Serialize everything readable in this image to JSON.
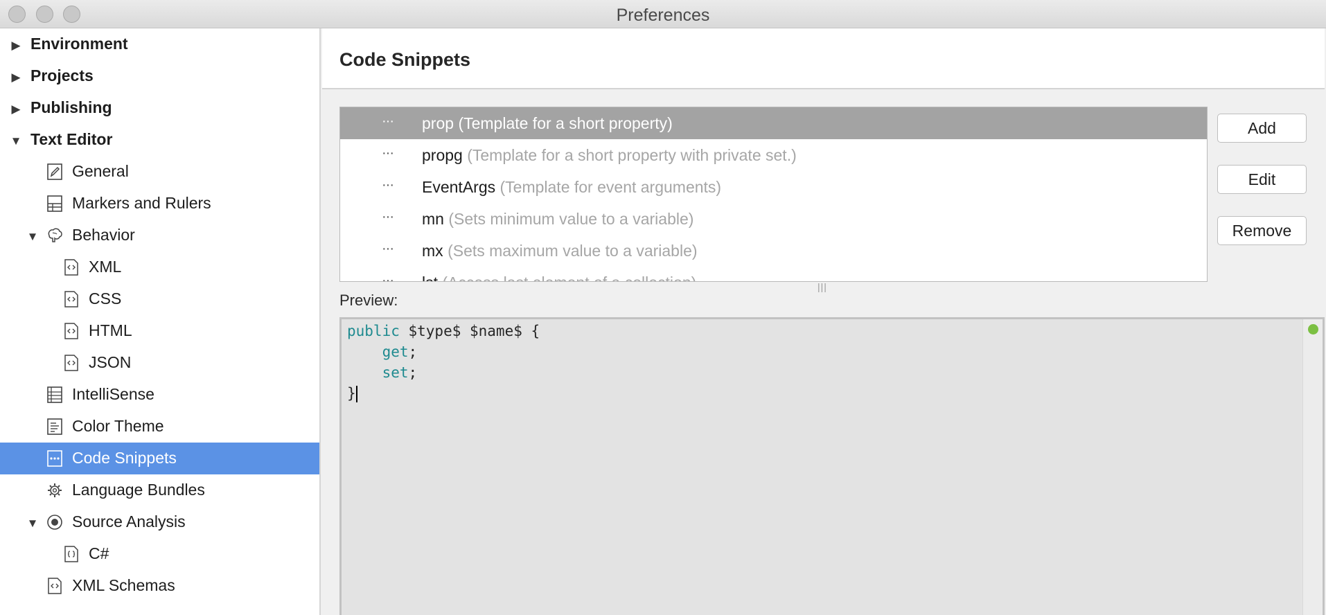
{
  "window": {
    "title": "Preferences"
  },
  "sidebar": {
    "items": [
      {
        "label": "Environment",
        "level": 0,
        "expanded": false
      },
      {
        "label": "Projects",
        "level": 0,
        "expanded": false
      },
      {
        "label": "Publishing",
        "level": 0,
        "expanded": false
      },
      {
        "label": "Text Editor",
        "level": 0,
        "expanded": true
      },
      {
        "label": "General",
        "icon": "pencil-icon"
      },
      {
        "label": "Markers and Rulers",
        "icon": "grid-icon"
      },
      {
        "label": "Behavior",
        "icon": "brain-icon",
        "expanded": true
      },
      {
        "label": "XML",
        "icon": "code-file-icon"
      },
      {
        "label": "CSS",
        "icon": "code-file-icon"
      },
      {
        "label": "HTML",
        "icon": "code-file-icon"
      },
      {
        "label": "JSON",
        "icon": "code-file-icon"
      },
      {
        "label": "IntelliSense",
        "icon": "list-icon"
      },
      {
        "label": "Color Theme",
        "icon": "document-icon"
      },
      {
        "label": "Code Snippets",
        "icon": "snippet-icon",
        "selected": true
      },
      {
        "label": "Language Bundles",
        "icon": "gear-icon"
      },
      {
        "label": "Source Analysis",
        "icon": "radio-icon",
        "expanded": true
      },
      {
        "label": "C#",
        "icon": "braces-file-icon"
      },
      {
        "label": "XML Schemas",
        "icon": "code-file-icon"
      }
    ]
  },
  "panel": {
    "title": "Code Snippets"
  },
  "snippets": [
    {
      "name": "prop",
      "description": "(Template for a short property)",
      "selected": true
    },
    {
      "name": "propg",
      "description": "(Template for a short property with private set.)"
    },
    {
      "name": "EventArgs",
      "description": "(Template for event arguments)"
    },
    {
      "name": "mn",
      "description": "(Sets minimum value to a variable)"
    },
    {
      "name": "mx",
      "description": "(Sets maximum value to a variable)"
    },
    {
      "name": "lst",
      "description": "(Access last element of a collection)"
    }
  ],
  "buttons": {
    "add": "Add",
    "edit": "Edit",
    "remove": "Remove"
  },
  "preview": {
    "label": "Preview:",
    "code": {
      "kw_public": "public",
      "line1_rest": " $type$ $name$ {",
      "kw_get": "get",
      "kw_set": "set",
      "semicolon": ";",
      "close": "}"
    }
  },
  "colors": {
    "selection": "#5b92e5",
    "keyword": "#1e8a8f",
    "status_ok": "#7cc043"
  }
}
